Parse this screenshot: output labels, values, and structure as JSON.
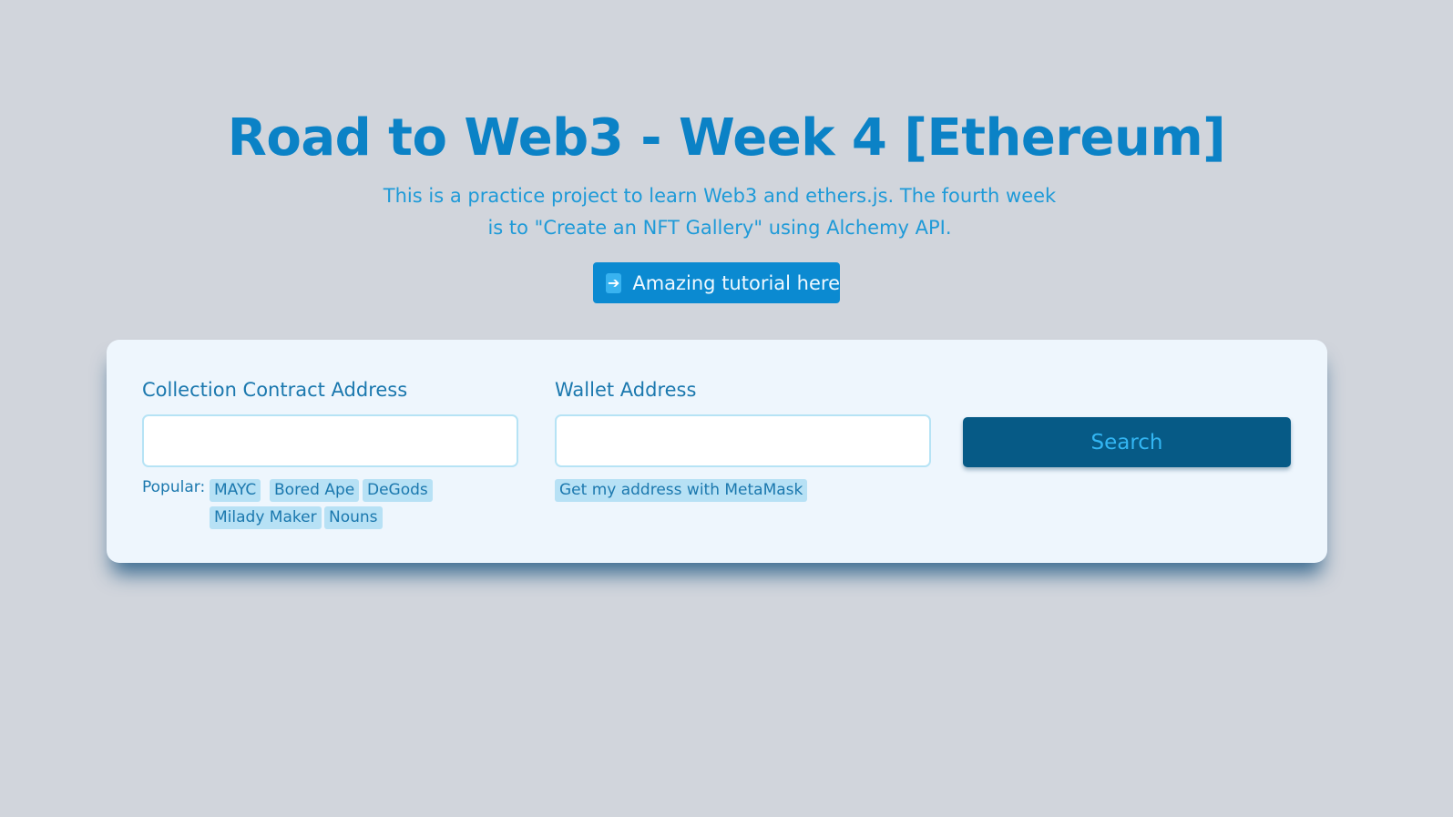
{
  "header": {
    "title": "Road to Web3 - Week 4 [Ethereum]",
    "subtitle": "This is a practice project to learn Web3 and ethers.js. The fourth week is to \"Create an NFT Gallery\" using Alchemy API.",
    "tutorial_button": {
      "icon": "right-arrow-icon",
      "label": "Amazing tutorial here"
    }
  },
  "form": {
    "collection": {
      "label": "Collection Contract Address",
      "value": "",
      "placeholder": "",
      "popular_label": "Popular:",
      "popular": [
        "MAYC",
        "Bored Ape",
        "DeGods",
        "Milady Maker",
        "Nouns"
      ]
    },
    "wallet": {
      "label": "Wallet Address",
      "value": "",
      "placeholder": "",
      "metamask_label": "Get my address with MetaMask"
    },
    "search_label": "Search"
  },
  "colors": {
    "background": "#d1d5dc",
    "title": "#0b82c6",
    "subtitle": "#1e9ad8",
    "tutorial_button": "#0b8ad1",
    "card": "#eef6fd",
    "search_button": "#065a86",
    "chip": "#b7e1f5"
  }
}
